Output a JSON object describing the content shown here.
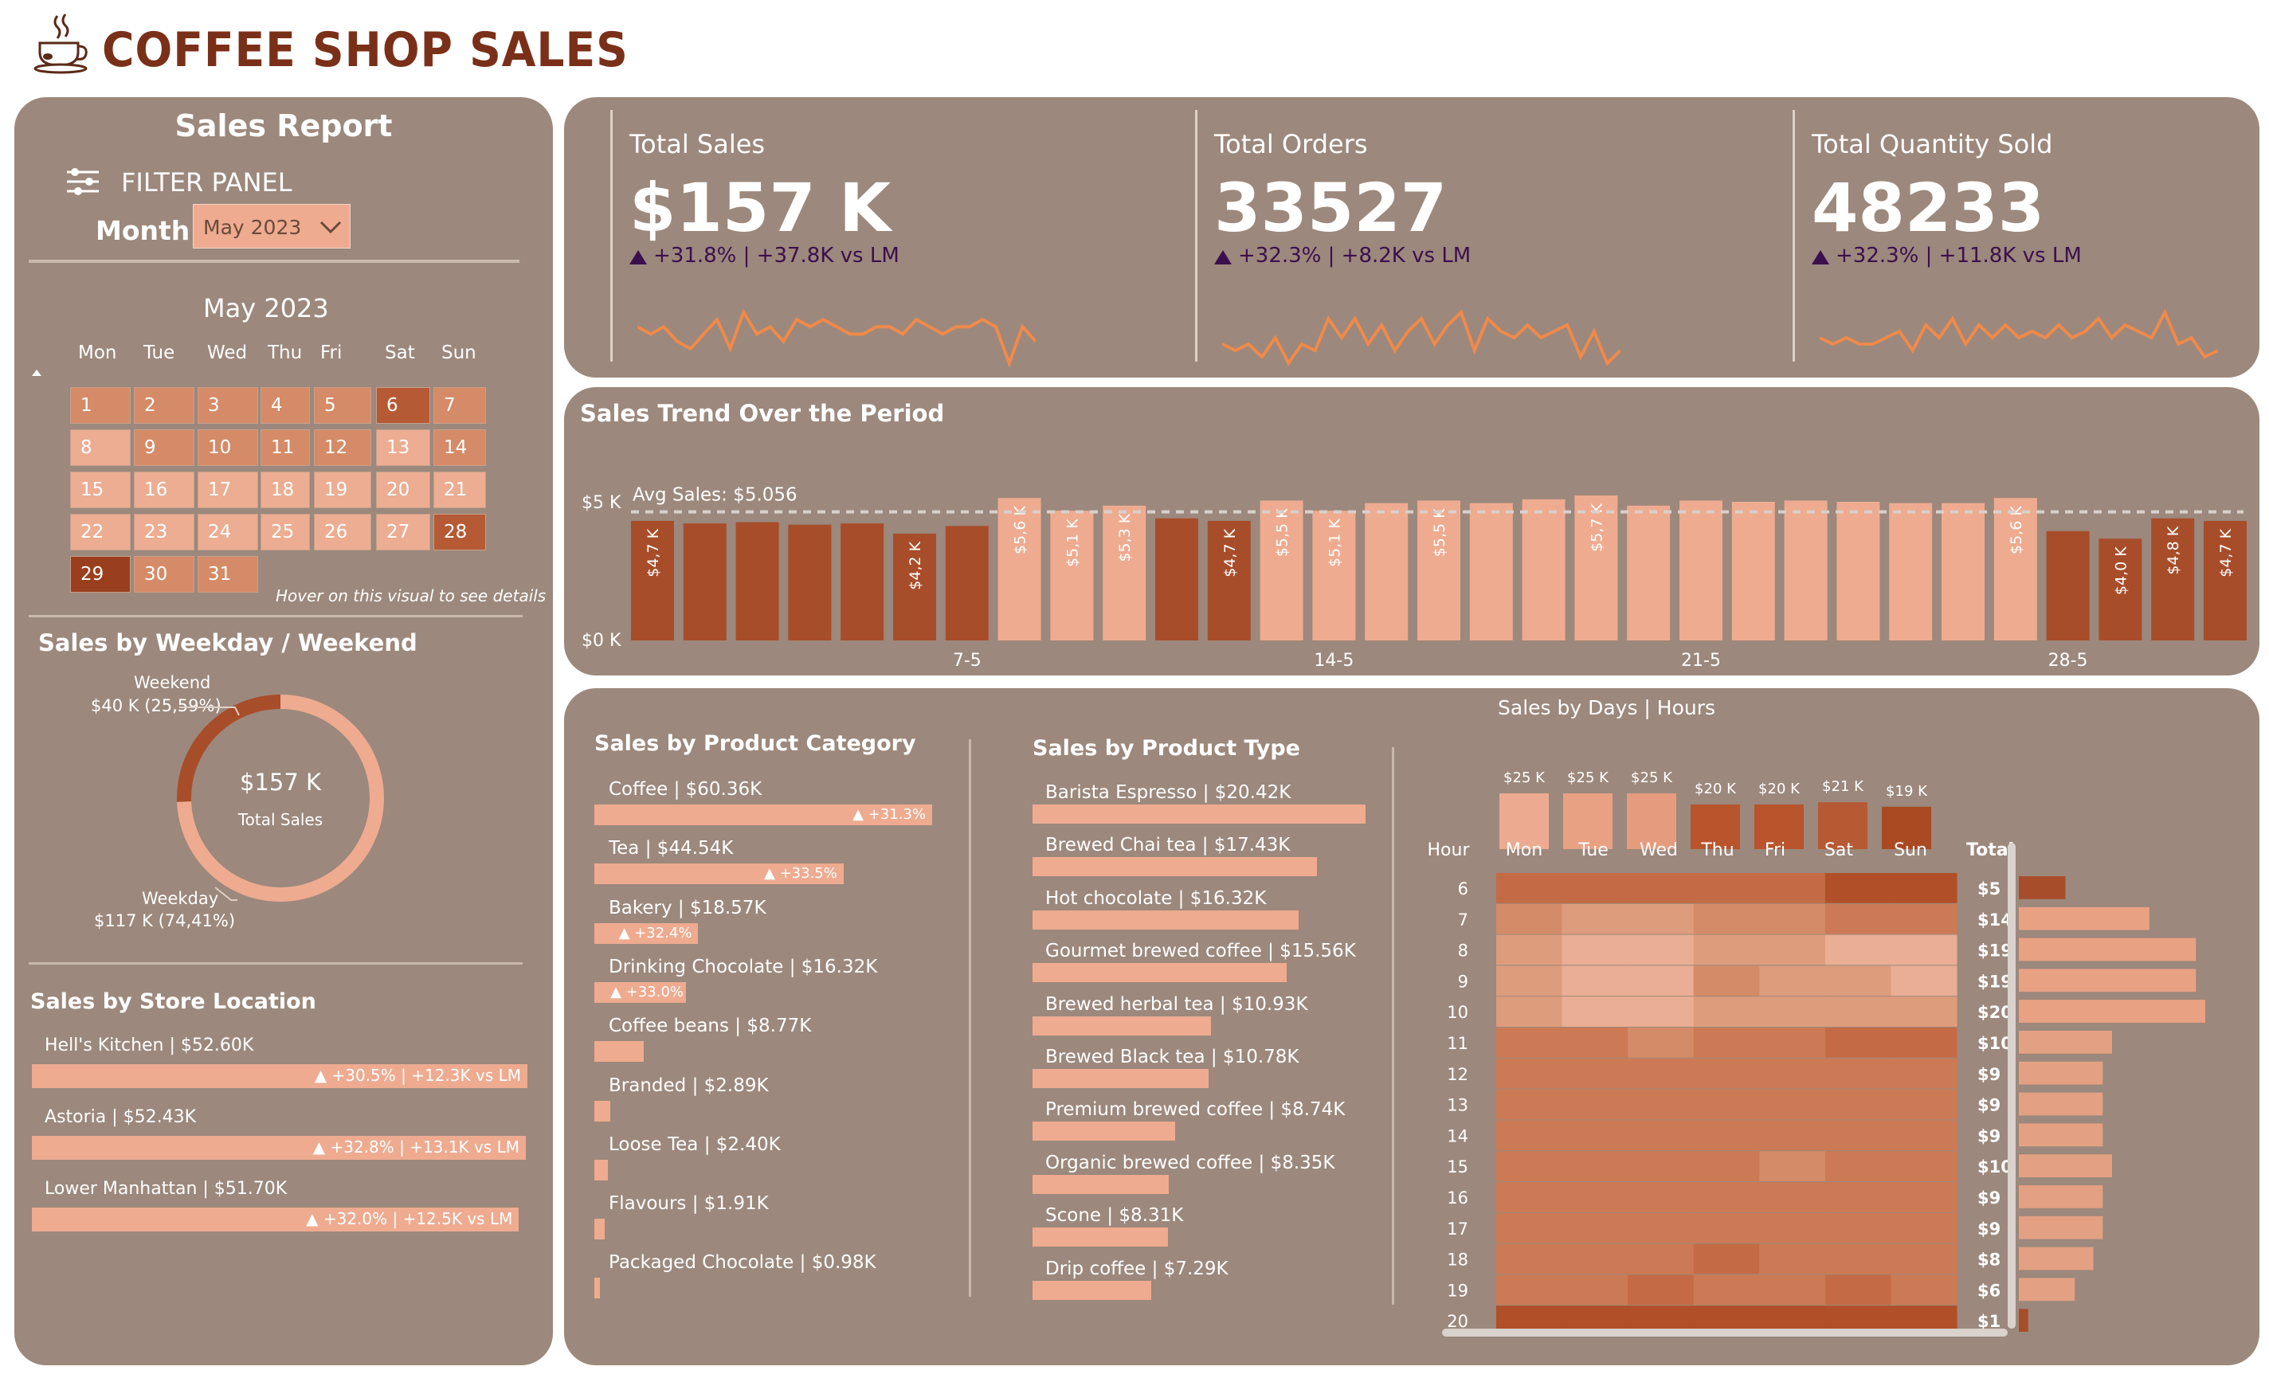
{
  "app": {
    "title": "COFFEE SHOP SALES"
  },
  "colors": {
    "panel": "#9c887c",
    "dark": "#a84d2a",
    "mid": "#d28a68",
    "light": "#eeab90",
    "title": "#7a3018",
    "delta": "#3b0f4e"
  },
  "filter": {
    "report_title": "Sales Report",
    "panel_label": "FILTER PANEL",
    "month_label": "Month",
    "month_value": "May 2023"
  },
  "calendar": {
    "title": "May 2023",
    "days_of_week": [
      "Mon",
      "Tue",
      "Wed",
      "Thu",
      "Fri",
      "Sat",
      "Sun"
    ],
    "hint": "Hover on this visual to see details",
    "days": [
      {
        "d": "1",
        "level": "mid"
      },
      {
        "d": "2",
        "level": "mid"
      },
      {
        "d": "3",
        "level": "mid"
      },
      {
        "d": "4",
        "level": "mid"
      },
      {
        "d": "5",
        "level": "mid"
      },
      {
        "d": "6",
        "level": "dark"
      },
      {
        "d": "7",
        "level": "mid"
      },
      {
        "d": "8",
        "level": "light"
      },
      {
        "d": "9",
        "level": "mid"
      },
      {
        "d": "10",
        "level": "mid"
      },
      {
        "d": "11",
        "level": "mid"
      },
      {
        "d": "12",
        "level": "mid"
      },
      {
        "d": "13",
        "level": "light"
      },
      {
        "d": "14",
        "level": "mid"
      },
      {
        "d": "15",
        "level": "light"
      },
      {
        "d": "16",
        "level": "light"
      },
      {
        "d": "17",
        "level": "light"
      },
      {
        "d": "18",
        "level": "light"
      },
      {
        "d": "19",
        "level": "light"
      },
      {
        "d": "20",
        "level": "light"
      },
      {
        "d": "21",
        "level": "light"
      },
      {
        "d": "22",
        "level": "light"
      },
      {
        "d": "23",
        "level": "light"
      },
      {
        "d": "24",
        "level": "light"
      },
      {
        "d": "25",
        "level": "light"
      },
      {
        "d": "26",
        "level": "light"
      },
      {
        "d": "27",
        "level": "light"
      },
      {
        "d": "28",
        "level": "dark"
      },
      {
        "d": "29",
        "level": "darkest"
      },
      {
        "d": "30",
        "level": "mid"
      },
      {
        "d": "31",
        "level": "mid"
      }
    ]
  },
  "kpis": [
    {
      "label": "Total Sales",
      "value": "$157 K",
      "delta": "+31.8% | +37.8K vs LM",
      "spark": [
        5,
        4,
        5,
        3,
        2,
        4,
        6,
        2,
        7,
        4,
        5,
        3,
        6,
        5,
        6,
        5,
        4,
        4,
        5,
        5,
        4,
        6,
        5,
        4,
        5,
        5,
        6,
        5,
        0,
        5,
        3
      ]
    },
    {
      "label": "Total Orders",
      "value": "33527",
      "delta": "+32.3% | +8.2K vs LM",
      "spark": [
        3,
        2,
        3,
        1,
        4,
        0,
        3,
        2,
        7,
        4,
        7,
        3,
        6,
        2,
        5,
        7,
        3,
        6,
        8,
        2,
        7,
        5,
        4,
        6,
        4,
        5,
        6,
        1,
        5,
        0,
        2
      ]
    },
    {
      "label": "Total Quantity Sold",
      "value": "48233",
      "delta": "+32.3% | +11.8K vs LM",
      "spark": [
        4,
        3,
        4,
        3,
        3,
        4,
        5,
        2,
        6,
        4,
        7,
        3,
        6,
        4,
        6,
        4,
        5,
        4,
        6,
        4,
        5,
        7,
        4,
        6,
        5,
        4,
        8,
        3,
        4,
        1,
        2
      ]
    }
  ],
  "trend": {
    "title": "Sales Trend Over the Period",
    "avg_label": "Avg Sales: $5.056",
    "y_ticks": [
      "$5 K",
      "$0 K"
    ],
    "x_ticks": [
      "7-5",
      "14-5",
      "21-5",
      "28-5"
    ],
    "chart_data": {
      "type": "bar",
      "avg": 5.056,
      "ylim": [
        0,
        6
      ],
      "values": [
        4.7,
        4.6,
        4.65,
        4.55,
        4.6,
        4.2,
        4.5,
        5.6,
        5.1,
        5.3,
        4.8,
        4.7,
        5.5,
        5.1,
        5.4,
        5.5,
        5.4,
        5.55,
        5.7,
        5.3,
        5.5,
        5.45,
        5.5,
        5.45,
        5.4,
        5.4,
        5.6,
        4.3,
        4.0,
        4.8,
        4.7
      ],
      "above_avg": [
        false,
        false,
        false,
        false,
        false,
        false,
        false,
        true,
        true,
        true,
        false,
        false,
        true,
        true,
        true,
        true,
        true,
        true,
        true,
        true,
        true,
        true,
        true,
        true,
        true,
        true,
        true,
        false,
        false,
        false,
        false
      ],
      "labels": [
        "$4,7 K",
        "",
        "",
        "",
        "",
        "$4,2 K",
        "",
        "$5,6 K",
        "$5,1 K",
        "$5,3 K",
        "",
        "$4,7 K",
        "$5,5 K",
        "$5,1 K",
        "",
        "$5,5 K",
        "",
        "",
        "$5,7 K",
        "",
        "",
        "",
        "",
        "",
        "",
        "",
        "$5,6 K",
        "",
        "$4,0 K",
        "$4,8 K",
        "$4,7 K"
      ]
    }
  },
  "weekday": {
    "title": "Sales by Weekday / Weekend",
    "center_value": "$157 K",
    "center_label": "Total Sales",
    "weekend_label": "Weekend",
    "weekend_value": "$40 K (25,59%)",
    "weekday_label": "Weekday",
    "weekday_value": "$117 K (74,41%)",
    "chart_data": {
      "type": "pie",
      "slices": [
        {
          "name": "Weekend",
          "value": 25.59
        },
        {
          "name": "Weekday",
          "value": 74.41
        }
      ]
    }
  },
  "store": {
    "title": "Sales by Store Location",
    "items": [
      {
        "label": "Hell's Kitchen | $52.60K",
        "delta": "▲ +30.5% | +12.3K vs LM",
        "value": 52.6
      },
      {
        "label": "Astoria | $52.43K",
        "delta": "▲ +32.8% | +13.1K vs LM",
        "value": 52.43
      },
      {
        "label": "Lower Manhattan | $51.70K",
        "delta": "▲ +32.0% | +12.5K vs LM",
        "value": 51.7
      }
    ]
  },
  "category": {
    "title": "Sales by Product Category",
    "items": [
      {
        "label": "Coffee | $60.36K",
        "value": 60.36,
        "delta": "▲ +31.3%"
      },
      {
        "label": "Tea | $44.54K",
        "value": 44.54,
        "delta": "▲ +33.5%"
      },
      {
        "label": "Bakery | $18.57K",
        "value": 18.57,
        "delta": "▲ +32.4%"
      },
      {
        "label": "Drinking Chocolate | $16.32K",
        "value": 16.32,
        "delta": "▲ +33.0%"
      },
      {
        "label": "Coffee beans | $8.77K",
        "value": 8.77,
        "delta": ""
      },
      {
        "label": "Branded | $2.89K",
        "value": 2.89,
        "delta": ""
      },
      {
        "label": "Loose Tea | $2.40K",
        "value": 2.4,
        "delta": ""
      },
      {
        "label": "Flavours | $1.91K",
        "value": 1.91,
        "delta": ""
      },
      {
        "label": "Packaged Chocolate | $0.98K",
        "value": 0.98,
        "delta": ""
      }
    ]
  },
  "ptype": {
    "title": "Sales by Product Type",
    "items": [
      {
        "label": "Barista Espresso | $20.42K",
        "value": 20.42
      },
      {
        "label": "Brewed Chai tea | $17.43K",
        "value": 17.43
      },
      {
        "label": "Hot chocolate | $16.32K",
        "value": 16.32
      },
      {
        "label": "Gourmet brewed coffee | $15.56K",
        "value": 15.56
      },
      {
        "label": "Brewed herbal tea | $10.93K",
        "value": 10.93
      },
      {
        "label": "Brewed Black tea | $10.78K",
        "value": 10.78
      },
      {
        "label": "Premium brewed coffee | $8.74K",
        "value": 8.74
      },
      {
        "label": "Organic brewed coffee | $8.35K",
        "value": 8.35
      },
      {
        "label": "Scone | $8.31K",
        "value": 8.31
      },
      {
        "label": "Drip coffee | $7.29K",
        "value": 7.29
      }
    ]
  },
  "heatmap": {
    "title": "Sales by Days | Hours",
    "hour_header": "Hour",
    "total_header": "Total",
    "days": [
      "Mon",
      "Tue",
      "Wed",
      "Thu",
      "Fri",
      "Sat",
      "Sun"
    ],
    "day_totals": [
      "$25 K",
      "$25 K",
      "$25 K",
      "$20 K",
      "$20 K",
      "$21 K",
      "$19 K"
    ],
    "day_values": [
      25,
      25,
      25,
      20,
      20,
      21,
      19
    ],
    "hours": [
      "6",
      "7",
      "8",
      "9",
      "10",
      "11",
      "12",
      "13",
      "14",
      "15",
      "16",
      "17",
      "18",
      "19",
      "20"
    ],
    "hour_totals": [
      "$5 I",
      "$14 I",
      "$19 I",
      "$19 I",
      "$20 I",
      "$10 I",
      "$9 I",
      "$9 I",
      "$9 I",
      "$10 I",
      "$9 I",
      "$9 I",
      "$8 I",
      "$6 I",
      "$1 I"
    ],
    "hour_values": [
      5,
      14,
      19,
      19,
      20,
      10,
      9,
      9,
      9,
      10,
      9,
      9,
      8,
      6,
      1
    ],
    "chart_data": {
      "type": "heatmap",
      "rows": [
        [
          2,
          2,
          2,
          2,
          2,
          1,
          1
        ],
        [
          4,
          5,
          5,
          4,
          4,
          3,
          3
        ],
        [
          5,
          6,
          6,
          5,
          5,
          6,
          6
        ],
        [
          5,
          6,
          6,
          4,
          5,
          5,
          6
        ],
        [
          5,
          6,
          6,
          5,
          5,
          5,
          5
        ],
        [
          3,
          3,
          4,
          3,
          3,
          2,
          2
        ],
        [
          3,
          3,
          3,
          3,
          3,
          3,
          3
        ],
        [
          3,
          3,
          3,
          3,
          3,
          3,
          3
        ],
        [
          3,
          3,
          3,
          3,
          3,
          3,
          3
        ],
        [
          3,
          3,
          3,
          3,
          4,
          3,
          3
        ],
        [
          3,
          3,
          3,
          3,
          3,
          3,
          3
        ],
        [
          3,
          3,
          3,
          3,
          3,
          3,
          3
        ],
        [
          3,
          3,
          3,
          2,
          3,
          3,
          3
        ],
        [
          3,
          3,
          2,
          3,
          3,
          2,
          3
        ],
        [
          1,
          1,
          1,
          1,
          1,
          1,
          1
        ]
      ]
    }
  }
}
